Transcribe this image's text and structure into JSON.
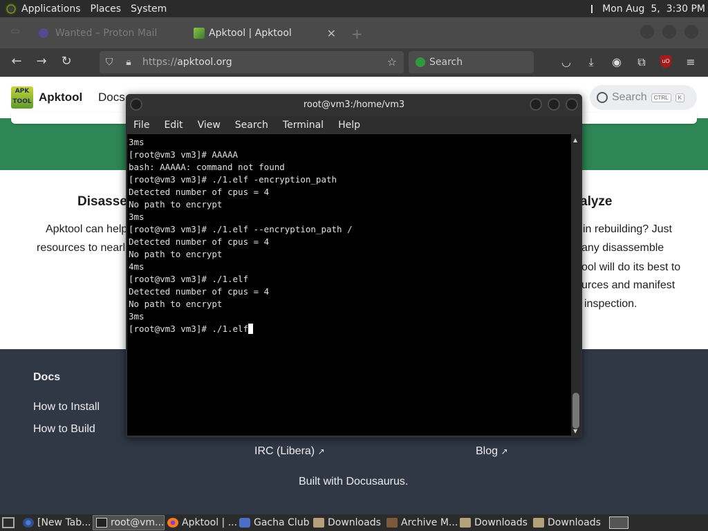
{
  "top_panel": {
    "menus": [
      "Applications",
      "Places",
      "System"
    ],
    "datetime": "Mon Aug  5,  3:30 PM"
  },
  "browser": {
    "tabs": [
      {
        "label": "Wanted – Proton Mail",
        "active": false
      },
      {
        "label": "Apktool | Apktool",
        "active": true
      }
    ],
    "url_protocol": "https://",
    "url_host": "apktool.org",
    "search_placeholder": "Search",
    "icons": [
      "back-icon",
      "forward-icon",
      "reload-icon",
      "shield-icon",
      "lock-icon",
      "star-icon",
      "pocket-icon",
      "download-icon",
      "account-icon",
      "extensions-icon",
      "ublock-icon",
      "menu-icon"
    ]
  },
  "site": {
    "name": "Apktool",
    "nav_docs": "Docs",
    "search_placeholder": "Search",
    "search_kbd": [
      "CTRL",
      "K"
    ],
    "features": {
      "left_title": "Disasse",
      "left_lines": [
        "Apktool can help",
        "resources to nearl"
      ],
      "right_title": "alyze",
      "right_lines": [
        "in rebuilding? Just",
        "any disassemble",
        "ool will do its best to",
        "urces and manifest",
        "inspection."
      ]
    },
    "footer": {
      "heading": "Docs",
      "links": [
        "How to Install",
        "How to Build"
      ],
      "irc": "IRC (Libera)",
      "blog": "Blog",
      "built_with": "Built with Docusaurus."
    }
  },
  "terminal": {
    "title": "root@vm3:/home/vm3",
    "menu": [
      "File",
      "Edit",
      "View",
      "Search",
      "Terminal",
      "Help"
    ],
    "lines": [
      "3ms",
      "[root@vm3 vm3]# AAAAA",
      "bash: AAAAA: command not found",
      "[root@vm3 vm3]# ./1.elf -encryption_path",
      "Detected number of cpus = 4",
      "No path to encrypt",
      "3ms",
      "[root@vm3 vm3]# ./1.elf --encryption_path /",
      "Detected number of cpus = 4",
      "No path to encrypt",
      "4ms",
      "[root@vm3 vm3]# ./1.elf",
      "Detected number of cpus = 4",
      "No path to encrypt",
      "3ms"
    ],
    "prompt": "[root@vm3 vm3]# ./1.elf"
  },
  "taskbar": {
    "items": [
      {
        "label": "[New Tab...",
        "icon": "chromium-icon",
        "active": false
      },
      {
        "label": "root@vm...",
        "icon": "terminal-icon",
        "active": true
      },
      {
        "label": "Apktool | ...",
        "icon": "firefox-icon",
        "active": false
      },
      {
        "label": "Gacha Club",
        "icon": "app-icon",
        "active": false
      },
      {
        "label": "Downloads",
        "icon": "folder-icon",
        "active": false
      },
      {
        "label": "Archive M...",
        "icon": "archive-icon",
        "active": false
      },
      {
        "label": "Downloads",
        "icon": "folder-icon",
        "active": false
      },
      {
        "label": "Downloads",
        "icon": "folder-icon",
        "active": false
      }
    ]
  }
}
